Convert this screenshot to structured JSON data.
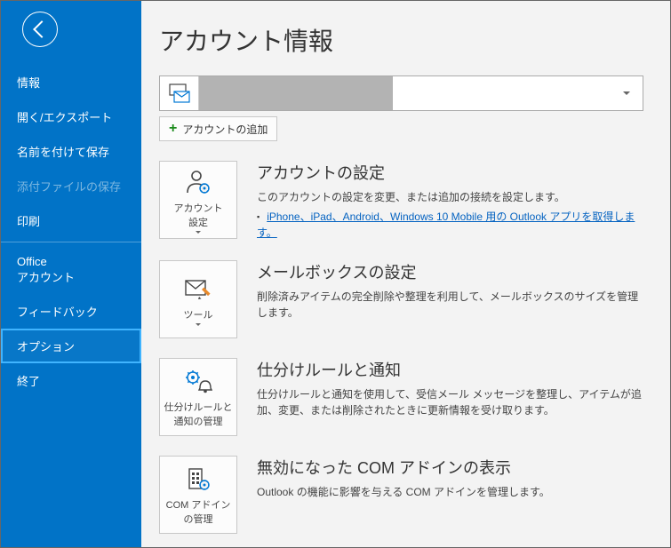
{
  "sidebar": {
    "items": [
      {
        "label": "情報",
        "state": "normal"
      },
      {
        "label": "開く/エクスポート",
        "state": "normal"
      },
      {
        "label": "名前を付けて保存",
        "state": "normal"
      },
      {
        "label": "添付ファイルの保存",
        "state": "disabled"
      },
      {
        "label": "印刷",
        "state": "normal"
      },
      {
        "label": "Office\nアカウント",
        "state": "normal"
      },
      {
        "label": "フィードバック",
        "state": "normal"
      },
      {
        "label": "オプション",
        "state": "selected"
      },
      {
        "label": "終了",
        "state": "normal"
      }
    ]
  },
  "main": {
    "title": "アカウント情報",
    "add_account_label": "アカウントの追加",
    "sections": [
      {
        "tile_label": "アカウント\n設定",
        "title": "アカウントの設定",
        "desc": "このアカウントの設定を変更、または追加の接続を設定します。",
        "link": "iPhone、iPad、Android、Windows 10 Mobile 用の Outlook アプリを取得します。",
        "has_caret": true
      },
      {
        "tile_label": "ツール",
        "title": "メールボックスの設定",
        "desc": "削除済みアイテムの完全削除や整理を利用して、メールボックスのサイズを管理します。",
        "has_caret": true
      },
      {
        "tile_label": "仕分けルールと\n通知の管理",
        "title": "仕分けルールと通知",
        "desc": "仕分けルールと通知を使用して、受信メール メッセージを整理し、アイテムが追加、変更、または削除されたときに更新情報を受け取ります。",
        "has_caret": false
      },
      {
        "tile_label": "COM アドイン\nの管理",
        "title": "無効になった COM アドインの表示",
        "desc": "Outlook の機能に影響を与える COM アドインを管理します。",
        "has_caret": false
      }
    ]
  }
}
